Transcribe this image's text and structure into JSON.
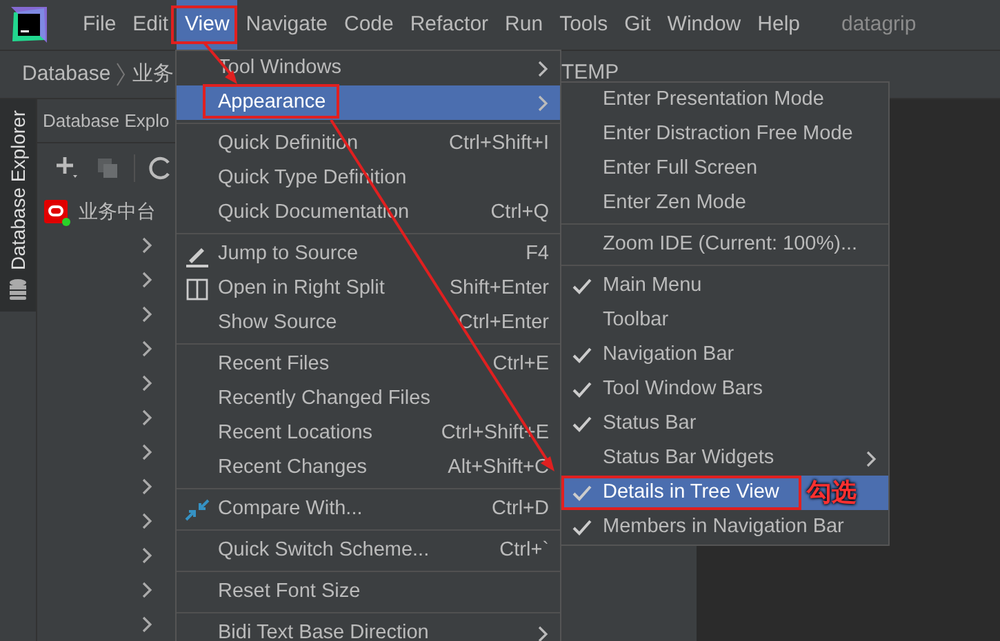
{
  "menu_bar": [
    {
      "label": "File",
      "selected": false
    },
    {
      "label": "Edit",
      "selected": false
    },
    {
      "label": "View",
      "selected": true
    },
    {
      "label": "Navigate",
      "selected": false
    },
    {
      "label": "Code",
      "selected": false
    },
    {
      "label": "Refactor",
      "selected": false
    },
    {
      "label": "Run",
      "selected": false
    },
    {
      "label": "Tools",
      "selected": false
    },
    {
      "label": "Git",
      "selected": false
    },
    {
      "label": "Window",
      "selected": false
    },
    {
      "label": "Help",
      "selected": false
    }
  ],
  "window": {
    "title": "datagrip"
  },
  "breadcrumb": [
    "Database",
    "业务",
    "TEMP"
  ],
  "side_tab": {
    "label": "Database Explorer"
  },
  "explorer": {
    "title": "Database Explo",
    "root": "业务中台"
  },
  "view_menu": [
    {
      "kind": "item",
      "label": "Tool Windows",
      "submenu": true,
      "selected": false
    },
    {
      "kind": "item",
      "label": "Appearance",
      "submenu": true,
      "selected": true
    },
    {
      "kind": "separator"
    },
    {
      "kind": "item",
      "label": "Quick Definition",
      "shortcut": "Ctrl+Shift+I",
      "selected": false
    },
    {
      "kind": "item",
      "label": "Quick Type Definition",
      "selected": false
    },
    {
      "kind": "item",
      "label": "Quick Documentation",
      "shortcut": "Ctrl+Q",
      "selected": false
    },
    {
      "kind": "separator"
    },
    {
      "kind": "item",
      "label": "Jump to Source",
      "shortcut": "F4",
      "selected": false
    },
    {
      "kind": "item",
      "label": "Open in Right Split",
      "shortcut": "Shift+Enter",
      "selected": false
    },
    {
      "kind": "item",
      "label": "Show Source",
      "shortcut": "Ctrl+Enter",
      "selected": false
    },
    {
      "kind": "separator"
    },
    {
      "kind": "item",
      "label": "Recent Files",
      "shortcut": "Ctrl+E",
      "selected": false
    },
    {
      "kind": "item",
      "label": "Recently Changed Files",
      "selected": false
    },
    {
      "kind": "item",
      "label": "Recent Locations",
      "shortcut": "Ctrl+Shift+E",
      "selected": false
    },
    {
      "kind": "item",
      "label": "Recent Changes",
      "shortcut": "Alt+Shift+C",
      "selected": false
    },
    {
      "kind": "separator"
    },
    {
      "kind": "item",
      "label": "Compare With...",
      "shortcut": "Ctrl+D",
      "selected": false
    },
    {
      "kind": "separator"
    },
    {
      "kind": "item",
      "label": "Quick Switch Scheme...",
      "shortcut": "Ctrl+`",
      "selected": false
    },
    {
      "kind": "separator"
    },
    {
      "kind": "item",
      "label": "Reset Font Size",
      "selected": false
    },
    {
      "kind": "separator"
    },
    {
      "kind": "item",
      "label": "Bidi Text Base Direction",
      "submenu": true,
      "selected": false
    }
  ],
  "appearance_menu": [
    {
      "kind": "item",
      "label": "Enter Presentation Mode",
      "checked": false,
      "selected": false
    },
    {
      "kind": "item",
      "label": "Enter Distraction Free Mode",
      "checked": false,
      "selected": false
    },
    {
      "kind": "item",
      "label": "Enter Full Screen",
      "checked": false,
      "selected": false
    },
    {
      "kind": "item",
      "label": "Enter Zen Mode",
      "checked": false,
      "selected": false
    },
    {
      "kind": "separator"
    },
    {
      "kind": "item",
      "label": "Zoom IDE (Current: 100%)...",
      "checked": false,
      "selected": false
    },
    {
      "kind": "separator"
    },
    {
      "kind": "item",
      "label": "Main Menu",
      "checked": true,
      "selected": false
    },
    {
      "kind": "item",
      "label": "Toolbar",
      "checked": false,
      "selected": false
    },
    {
      "kind": "item",
      "label": "Navigation Bar",
      "checked": true,
      "selected": false
    },
    {
      "kind": "item",
      "label": "Tool Window Bars",
      "checked": true,
      "selected": false
    },
    {
      "kind": "item",
      "label": "Status Bar",
      "checked": true,
      "selected": false
    },
    {
      "kind": "item",
      "label": "Status Bar Widgets",
      "checked": false,
      "submenu": true,
      "selected": false
    },
    {
      "kind": "item",
      "label": "Details in Tree View",
      "checked": true,
      "selected": true
    },
    {
      "kind": "item",
      "label": "Members in Navigation Bar",
      "checked": true,
      "selected": false
    }
  ],
  "annotation": {
    "note": "勾选"
  }
}
